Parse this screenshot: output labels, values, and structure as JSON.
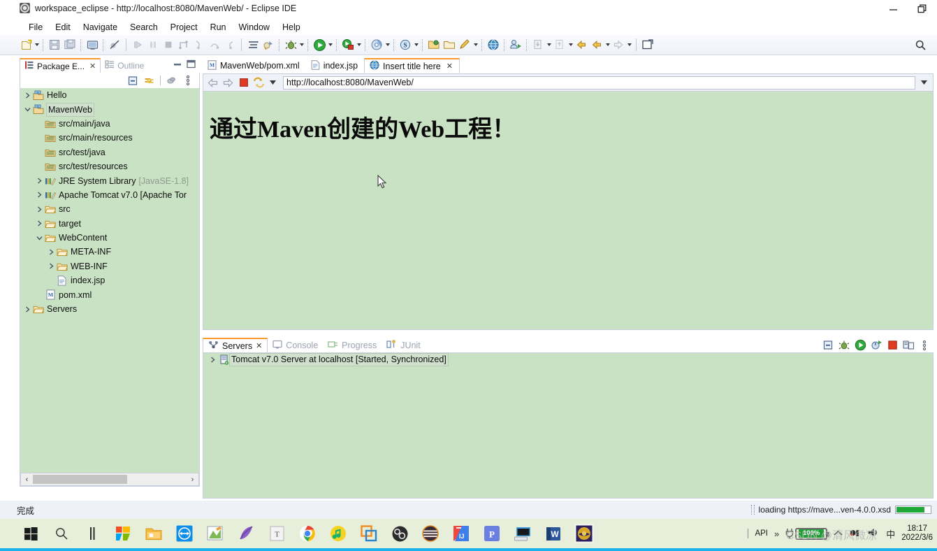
{
  "window": {
    "title": "workspace_eclipse - http://localhost:8080/MavenWeb/ - Eclipse IDE",
    "app_icon": "eclipse-icon",
    "minimize": "—",
    "restore": "❐"
  },
  "menubar": {
    "items": [
      "File",
      "Edit",
      "Navigate",
      "Search",
      "Project",
      "Run",
      "Window",
      "Help"
    ]
  },
  "toolbar": {
    "search_icon": "search-icon",
    "groups": [
      [
        "new-wizard",
        "save",
        "save-all",
        "print-preview"
      ],
      [
        "skip-breakpoints"
      ],
      [
        "resume",
        "suspend",
        "terminate",
        "disconnect",
        "step-into",
        "step-over",
        "step-return"
      ],
      [
        "new-java-package",
        "new-java-class"
      ],
      [
        "debug",
        "run",
        "run-external-tools"
      ],
      [
        "coverage",
        "open-type"
      ],
      [
        "new-project-wizard",
        "open-folder",
        "edit"
      ],
      [
        "open-web-browser",
        "profile"
      ],
      [
        "import",
        "export"
      ],
      [
        "back",
        "forward",
        "next-annotation"
      ],
      [
        "new-editor"
      ]
    ]
  },
  "left_panel": {
    "tabs": [
      {
        "label": "Package E...",
        "icon": "package-explorer-icon",
        "active": true,
        "closeable": true
      },
      {
        "label": "Outline",
        "icon": "outline-icon",
        "active": false,
        "closeable": false
      }
    ],
    "minimize_icon": "minimize-icon",
    "maximize_icon": "maximize-icon",
    "view_toolbar": [
      "collapse-all-icon",
      "link-with-editor-icon",
      "focus-on-active-task-icon",
      "view-menu-icon"
    ],
    "tree": [
      {
        "label": "Hello",
        "icon": "maven-project-icon",
        "arrow": "collapsed",
        "indent": 0,
        "selected": false
      },
      {
        "label": "MavenWeb",
        "icon": "maven-project-icon",
        "arrow": "expanded",
        "indent": 0,
        "selected": true
      },
      {
        "label": "src/main/java",
        "icon": "source-folder-icon",
        "arrow": "none",
        "indent": 1,
        "selected": false
      },
      {
        "label": "src/main/resources",
        "icon": "source-folder-icon",
        "arrow": "none",
        "indent": 1,
        "selected": false
      },
      {
        "label": "src/test/java",
        "icon": "source-folder-icon",
        "arrow": "none",
        "indent": 1,
        "selected": false
      },
      {
        "label": "src/test/resources",
        "icon": "source-folder-icon",
        "arrow": "none",
        "indent": 1,
        "selected": false
      },
      {
        "label": "JRE System Library",
        "suffix": "[JavaSE-1.8]",
        "icon": "library-icon",
        "arrow": "collapsed",
        "indent": 1,
        "selected": false
      },
      {
        "label": "Apache Tomcat v7.0 [Apache Tor",
        "icon": "library-icon",
        "arrow": "collapsed",
        "indent": 1,
        "selected": false
      },
      {
        "label": "src",
        "icon": "folder-icon",
        "arrow": "collapsed",
        "indent": 1,
        "selected": false
      },
      {
        "label": "target",
        "icon": "folder-icon",
        "arrow": "collapsed",
        "indent": 1,
        "selected": false
      },
      {
        "label": "WebContent",
        "icon": "folder-icon",
        "arrow": "expanded",
        "indent": 1,
        "selected": false
      },
      {
        "label": "META-INF",
        "icon": "folder-icon",
        "arrow": "collapsed",
        "indent": 2,
        "selected": false
      },
      {
        "label": "WEB-INF",
        "icon": "folder-icon",
        "arrow": "collapsed",
        "indent": 2,
        "selected": false
      },
      {
        "label": "index.jsp",
        "icon": "jsp-file-icon",
        "arrow": "none",
        "indent": 2,
        "selected": false
      },
      {
        "label": "pom.xml",
        "icon": "maven-pom-icon",
        "arrow": "none",
        "indent": 1,
        "selected": false
      },
      {
        "label": "Servers",
        "icon": "folder-icon",
        "arrow": "collapsed",
        "indent": 0,
        "selected": false
      }
    ],
    "hscroll": {
      "left_arrow": "‹",
      "right_arrow": "›"
    }
  },
  "editor": {
    "tabs": [
      {
        "label": "MavenWeb/pom.xml",
        "icon": "maven-pom-icon",
        "active": false,
        "closeable": false
      },
      {
        "label": "index.jsp",
        "icon": "jsp-file-icon",
        "active": false,
        "closeable": false
      },
      {
        "label": "Insert title here",
        "icon": "web-browser-icon",
        "active": true,
        "closeable": true
      }
    ],
    "nav": {
      "back_icon": "back-arrow-icon",
      "forward_icon": "forward-arrow-icon",
      "stop_icon": "stop-icon",
      "refresh_icon": "refresh-icon",
      "dropdown_icon": "chevron-down-icon",
      "url": "http://localhost:8080/MavenWeb/",
      "url_dropdown_icon": "chevron-down-icon"
    },
    "page": {
      "heading": "通过Maven创建的Web工程！",
      "background_color": "#c9e2c3",
      "cursor_icon": "mouse-pointer-icon"
    }
  },
  "servers_panel": {
    "tabs": [
      {
        "label": "Servers",
        "icon": "servers-icon",
        "active": true,
        "closeable": true
      },
      {
        "label": "Console",
        "icon": "console-icon",
        "active": false,
        "closeable": false
      },
      {
        "label": "Progress",
        "icon": "progress-icon",
        "active": false,
        "closeable": false
      },
      {
        "label": "JUnit",
        "icon": "junit-icon",
        "active": false,
        "closeable": false
      }
    ],
    "toolbar": [
      "collapse-all-icon",
      "debug-server-icon",
      "start-server-icon",
      "profile-server-icon",
      "stop-server-icon",
      "publish-icon",
      "view-menu-icon"
    ],
    "rows": [
      {
        "arrow": "collapsed",
        "icon": "tomcat-server-icon",
        "label": "Tomcat v7.0 Server at localhost  [Started, Synchronized]",
        "selected": true
      }
    ]
  },
  "statusbar": {
    "status_text": "完成",
    "loading_text": "loading https://mave...ven-4.0.0.xsd",
    "progress_percent": 80
  },
  "taskbar": {
    "icons": [
      "windows-start-icon",
      "search-icon",
      "task-view-icon",
      "microsoft-office-icon",
      "file-explorer-icon",
      "teamviewer-icon",
      "xmind-icon",
      "navicat-icon",
      "typora-icon",
      "google-chrome-icon",
      "qq-music-icon",
      "vmware-icon",
      "obs-studio-icon",
      "ubuntu-icon",
      "intellij-idea-icon",
      "pycharm-icon",
      "remote-desktop-icon",
      "microsoft-word-icon",
      "eclipse-icon"
    ],
    "tray": {
      "api_label": "API",
      "overflow_icon": "chevron-up-overflow-icon",
      "battery_percent": "100%",
      "chevron_icon": "chevron-up-icon",
      "network_icon": "network-icon",
      "volume_icon": "volume-icon",
      "ime_icon": "ime-icon",
      "ime_label": "中",
      "time": "18:17",
      "date": "2022/3/6"
    },
    "watermark": "CSDN @清风微凉"
  }
}
